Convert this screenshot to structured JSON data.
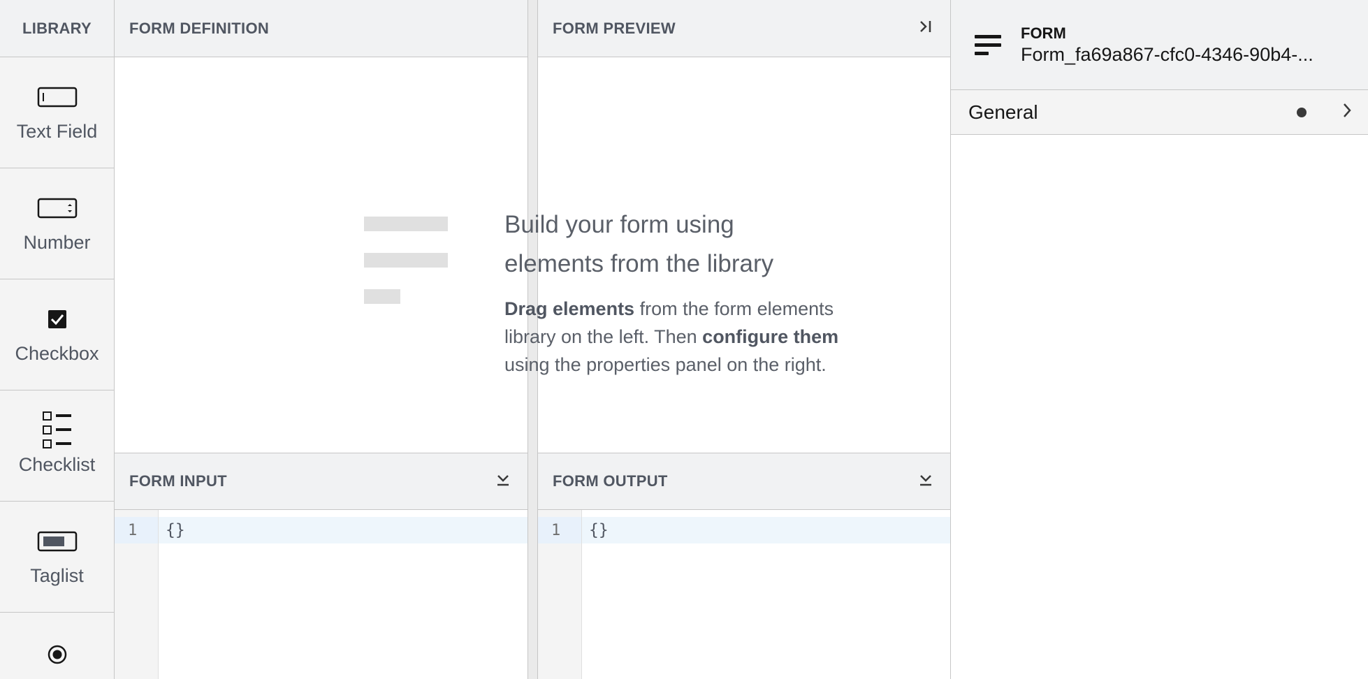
{
  "library": {
    "title": "LIBRARY",
    "items": [
      {
        "label": "Text Field",
        "icon": "text-field-icon"
      },
      {
        "label": "Number",
        "icon": "number-icon"
      },
      {
        "label": "Checkbox",
        "icon": "checkbox-icon"
      },
      {
        "label": "Checklist",
        "icon": "checklist-icon"
      },
      {
        "label": "Taglist",
        "icon": "taglist-icon"
      },
      {
        "label": "",
        "icon": "radio-icon"
      }
    ]
  },
  "definition": {
    "title": "FORM DEFINITION"
  },
  "preview": {
    "title": "FORM PREVIEW",
    "collapse_icon": "collapse-right-icon"
  },
  "empty_state": {
    "title": "Build your form using elements from the library",
    "desc_bold_1": "Drag elements",
    "desc_text_1": " from the form elements library on the left. Then ",
    "desc_bold_2": "configure them",
    "desc_text_2": " using the properties panel on the right."
  },
  "input": {
    "title": "FORM INPUT",
    "line_number": "1",
    "code": "{}"
  },
  "output": {
    "title": "FORM OUTPUT",
    "line_number": "1",
    "code": "{}"
  },
  "properties": {
    "type": "FORM",
    "name": "Form_fa69a867-cfc0-4346-90b4-...",
    "groups": [
      {
        "label": "General"
      }
    ]
  }
}
